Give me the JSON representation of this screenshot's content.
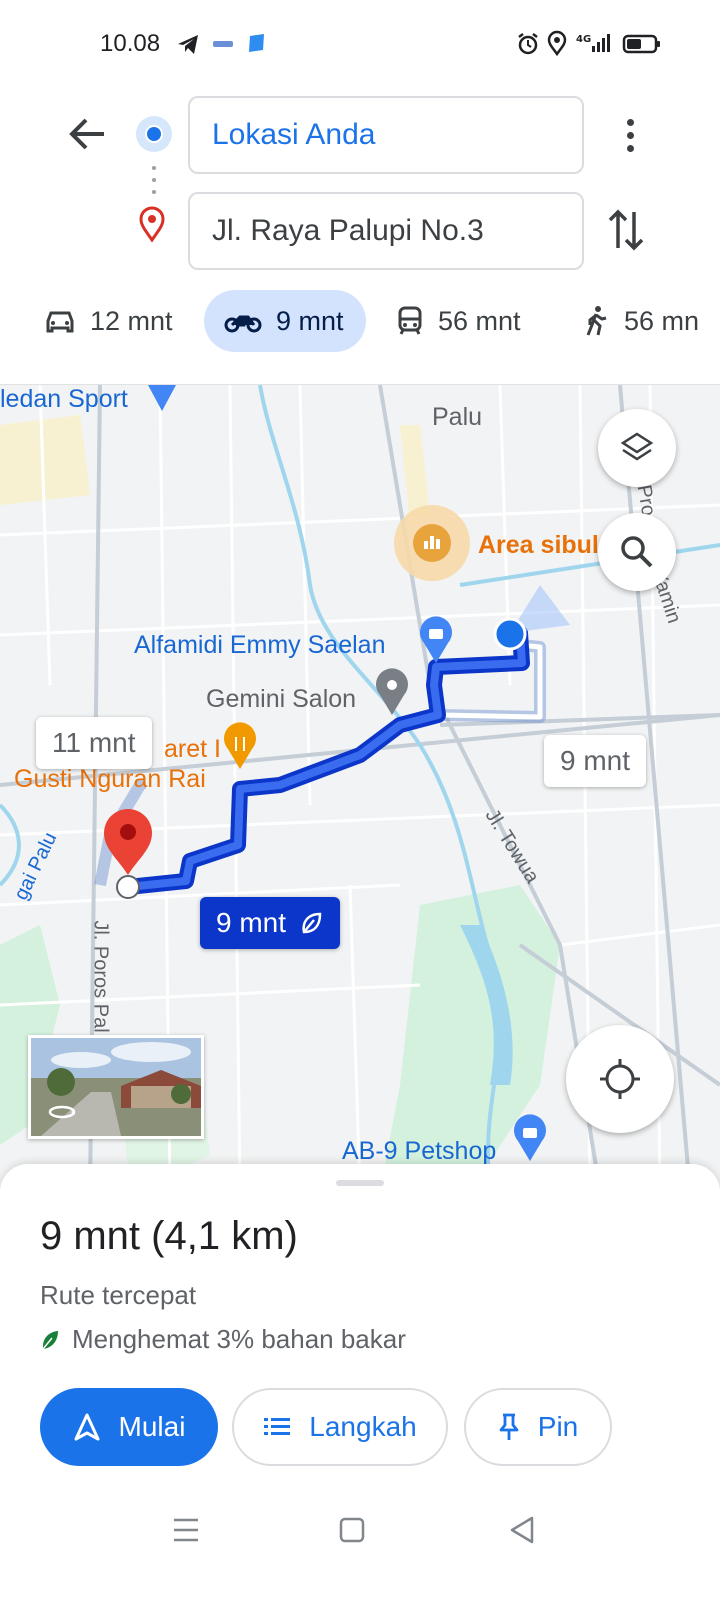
{
  "status_bar": {
    "time": "10.08",
    "network": "4G"
  },
  "directions": {
    "origin": "Lokasi Anda",
    "destination": "Jl. Raya Palupi No.3"
  },
  "modes": [
    {
      "name": "car",
      "label": "12 mnt",
      "selected": false
    },
    {
      "name": "motorcycle",
      "label": "9 mnt",
      "selected": true
    },
    {
      "name": "transit",
      "label": "56 mnt",
      "selected": false
    },
    {
      "name": "walk",
      "label": "56 mn",
      "selected": false
    }
  ],
  "map": {
    "labels": {
      "medan_sport": "ledan Sport",
      "palu": "Palu",
      "area_sibul": "Area sibul",
      "alfamidi": "Alfamidi Emmy Saelan",
      "gemini": "Gemini Salon",
      "restaurant_1": "aret I",
      "restaurant_2": "Gusti Nguran Rai",
      "jl_towua": "Jl. Towua",
      "jl_poros": "Jl. Poros Pal",
      "petshop": "AB-9 Petshop",
      "yamin": "Yamin",
      "pro": "Pro",
      "gai_palu": "gai Palu"
    },
    "route_times": {
      "alt_left": "11 mnt",
      "alt_right": "9 mnt",
      "primary": "9 mnt"
    }
  },
  "sheet": {
    "summary": "9 mnt (4,1 km)",
    "subtitle": "Rute tercepat",
    "fuel": "Menghemat 3% bahan bakar",
    "buttons": {
      "start": "Mulai",
      "steps": "Langkah",
      "pin": "Pin"
    }
  },
  "colors": {
    "accent": "#1a73e8",
    "route": "#0b36c9",
    "pin_red": "#ea4335",
    "fuel_green": "#188038"
  }
}
